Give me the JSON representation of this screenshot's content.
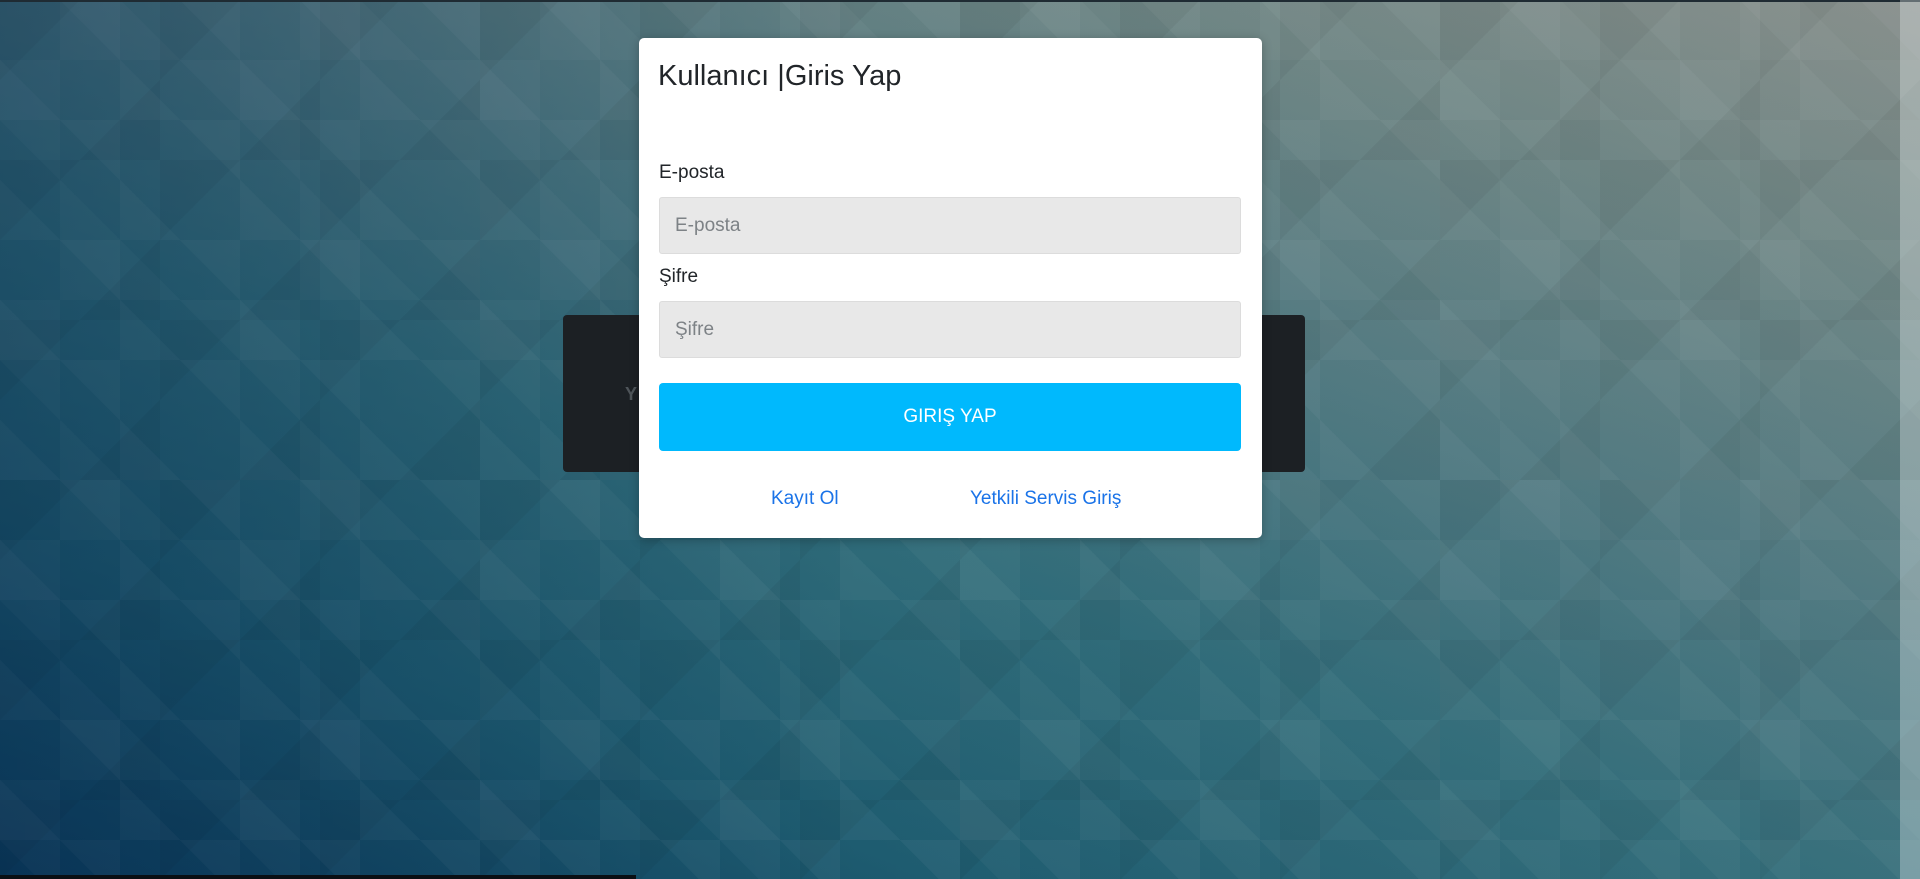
{
  "modal": {
    "title": "Kullanıcı |Giris Yap",
    "email_label": "E-posta",
    "email_placeholder": "E-posta",
    "email_value": "",
    "password_label": "Şifre",
    "password_placeholder": "Şifre",
    "password_value": "",
    "login_button_label": "GIRIŞ YAP",
    "register_link": "Kayıt Ol",
    "service_link": "Yetkili Servis Giriş"
  },
  "background_panel": {
    "visible_text": "Y"
  },
  "colors": {
    "primary_button": "#00b9fd",
    "link": "#1a73e8",
    "input_background": "#e8e8e8",
    "panel_dark": "#1c2024"
  }
}
